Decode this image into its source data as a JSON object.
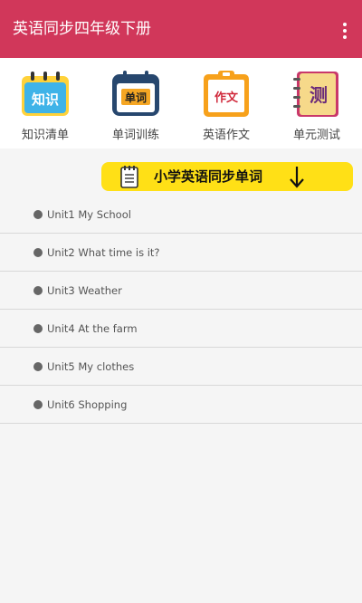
{
  "app": {
    "title": "英语同步四年级下册"
  },
  "quick_menu": [
    {
      "label": "知识清单",
      "icon_text": "知识",
      "icon": "knowledge-icon"
    },
    {
      "label": "单词训练",
      "icon_text": "单词",
      "icon": "calendar-vocab-icon"
    },
    {
      "label": "英语作文",
      "icon_text": "作文",
      "icon": "clipboard-essay-icon"
    },
    {
      "label": "单元测试",
      "icon_text": "测",
      "icon": "notebook-test-icon"
    }
  ],
  "banner": {
    "text": "小学英语同步单词",
    "icon": "note-icon",
    "arrow": "arrow-down-icon"
  },
  "units": [
    {
      "label": "Unit1 My School"
    },
    {
      "label": "Unit2 What time is it?"
    },
    {
      "label": "Unit3 Weather"
    },
    {
      "label": "Unit4 At the farm"
    },
    {
      "label": "Unit5 My clothes"
    },
    {
      "label": "Unit6 Shopping"
    }
  ],
  "colors": {
    "appbar": "#d1375a",
    "banner": "#ffe016",
    "background": "#f5f5f5"
  }
}
